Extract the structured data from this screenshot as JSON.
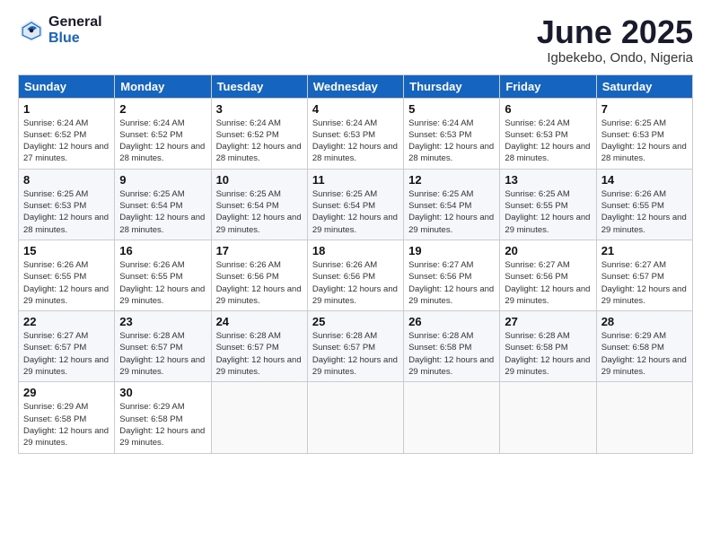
{
  "logo": {
    "general": "General",
    "blue": "Blue"
  },
  "title": "June 2025",
  "subtitle": "Igbekebo, Ondo, Nigeria",
  "weekdays": [
    "Sunday",
    "Monday",
    "Tuesday",
    "Wednesday",
    "Thursday",
    "Friday",
    "Saturday"
  ],
  "weeks": [
    [
      {
        "day": "1",
        "info": "Sunrise: 6:24 AM\nSunset: 6:52 PM\nDaylight: 12 hours and 27 minutes."
      },
      {
        "day": "2",
        "info": "Sunrise: 6:24 AM\nSunset: 6:52 PM\nDaylight: 12 hours and 28 minutes."
      },
      {
        "day": "3",
        "info": "Sunrise: 6:24 AM\nSunset: 6:52 PM\nDaylight: 12 hours and 28 minutes."
      },
      {
        "day": "4",
        "info": "Sunrise: 6:24 AM\nSunset: 6:53 PM\nDaylight: 12 hours and 28 minutes."
      },
      {
        "day": "5",
        "info": "Sunrise: 6:24 AM\nSunset: 6:53 PM\nDaylight: 12 hours and 28 minutes."
      },
      {
        "day": "6",
        "info": "Sunrise: 6:24 AM\nSunset: 6:53 PM\nDaylight: 12 hours and 28 minutes."
      },
      {
        "day": "7",
        "info": "Sunrise: 6:25 AM\nSunset: 6:53 PM\nDaylight: 12 hours and 28 minutes."
      }
    ],
    [
      {
        "day": "8",
        "info": "Sunrise: 6:25 AM\nSunset: 6:53 PM\nDaylight: 12 hours and 28 minutes."
      },
      {
        "day": "9",
        "info": "Sunrise: 6:25 AM\nSunset: 6:54 PM\nDaylight: 12 hours and 28 minutes."
      },
      {
        "day": "10",
        "info": "Sunrise: 6:25 AM\nSunset: 6:54 PM\nDaylight: 12 hours and 29 minutes."
      },
      {
        "day": "11",
        "info": "Sunrise: 6:25 AM\nSunset: 6:54 PM\nDaylight: 12 hours and 29 minutes."
      },
      {
        "day": "12",
        "info": "Sunrise: 6:25 AM\nSunset: 6:54 PM\nDaylight: 12 hours and 29 minutes."
      },
      {
        "day": "13",
        "info": "Sunrise: 6:25 AM\nSunset: 6:55 PM\nDaylight: 12 hours and 29 minutes."
      },
      {
        "day": "14",
        "info": "Sunrise: 6:26 AM\nSunset: 6:55 PM\nDaylight: 12 hours and 29 minutes."
      }
    ],
    [
      {
        "day": "15",
        "info": "Sunrise: 6:26 AM\nSunset: 6:55 PM\nDaylight: 12 hours and 29 minutes."
      },
      {
        "day": "16",
        "info": "Sunrise: 6:26 AM\nSunset: 6:55 PM\nDaylight: 12 hours and 29 minutes."
      },
      {
        "day": "17",
        "info": "Sunrise: 6:26 AM\nSunset: 6:56 PM\nDaylight: 12 hours and 29 minutes."
      },
      {
        "day": "18",
        "info": "Sunrise: 6:26 AM\nSunset: 6:56 PM\nDaylight: 12 hours and 29 minutes."
      },
      {
        "day": "19",
        "info": "Sunrise: 6:27 AM\nSunset: 6:56 PM\nDaylight: 12 hours and 29 minutes."
      },
      {
        "day": "20",
        "info": "Sunrise: 6:27 AM\nSunset: 6:56 PM\nDaylight: 12 hours and 29 minutes."
      },
      {
        "day": "21",
        "info": "Sunrise: 6:27 AM\nSunset: 6:57 PM\nDaylight: 12 hours and 29 minutes."
      }
    ],
    [
      {
        "day": "22",
        "info": "Sunrise: 6:27 AM\nSunset: 6:57 PM\nDaylight: 12 hours and 29 minutes."
      },
      {
        "day": "23",
        "info": "Sunrise: 6:28 AM\nSunset: 6:57 PM\nDaylight: 12 hours and 29 minutes."
      },
      {
        "day": "24",
        "info": "Sunrise: 6:28 AM\nSunset: 6:57 PM\nDaylight: 12 hours and 29 minutes."
      },
      {
        "day": "25",
        "info": "Sunrise: 6:28 AM\nSunset: 6:57 PM\nDaylight: 12 hours and 29 minutes."
      },
      {
        "day": "26",
        "info": "Sunrise: 6:28 AM\nSunset: 6:58 PM\nDaylight: 12 hours and 29 minutes."
      },
      {
        "day": "27",
        "info": "Sunrise: 6:28 AM\nSunset: 6:58 PM\nDaylight: 12 hours and 29 minutes."
      },
      {
        "day": "28",
        "info": "Sunrise: 6:29 AM\nSunset: 6:58 PM\nDaylight: 12 hours and 29 minutes."
      }
    ],
    [
      {
        "day": "29",
        "info": "Sunrise: 6:29 AM\nSunset: 6:58 PM\nDaylight: 12 hours and 29 minutes."
      },
      {
        "day": "30",
        "info": "Sunrise: 6:29 AM\nSunset: 6:58 PM\nDaylight: 12 hours and 29 minutes."
      },
      null,
      null,
      null,
      null,
      null
    ]
  ]
}
